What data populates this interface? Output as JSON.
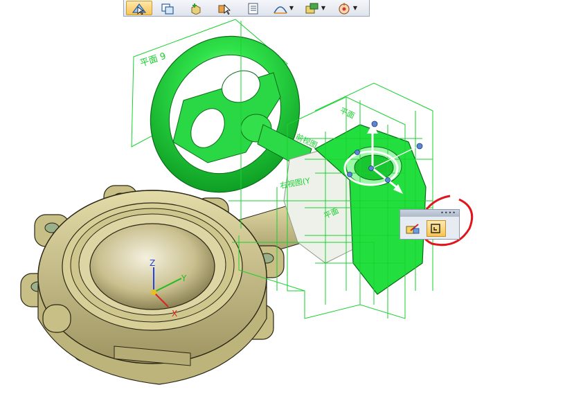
{
  "toolbar": {
    "buttons": [
      {
        "icon": "select-tool-icon",
        "active": true,
        "dropdown": false
      },
      {
        "icon": "copy-shape-icon",
        "active": false,
        "dropdown": false
      },
      {
        "icon": "add-part-icon",
        "active": false,
        "dropdown": false
      },
      {
        "icon": "pick-body-icon",
        "active": false,
        "dropdown": false
      },
      {
        "icon": "list-document-icon",
        "active": false,
        "dropdown": false
      },
      {
        "icon": "arc-sketch-icon",
        "active": false,
        "dropdown": true
      },
      {
        "icon": "dimension-icon",
        "active": false,
        "dropdown": true
      },
      {
        "icon": "target-relate-icon",
        "active": false,
        "dropdown": true
      }
    ]
  },
  "viewport": {
    "plane_label": "平面 9",
    "plane_labels_secondary": [
      "平面",
      "前视图",
      "右视图(Y",
      "平面"
    ],
    "triad": {
      "x": "X",
      "y": "Y",
      "z": "Z"
    }
  },
  "mini_toolbar": {
    "grip": "••••",
    "buttons": [
      {
        "icon": "edit-move-icon",
        "active": false
      },
      {
        "icon": "face-relate-icon",
        "active": true
      }
    ]
  },
  "colors": {
    "selected_green": "#1fe03a",
    "wire_green": "#19d12f",
    "body_tan": "#c8bf86",
    "highlight_red": "#e0161c",
    "active_orange": "#f7c45a"
  }
}
